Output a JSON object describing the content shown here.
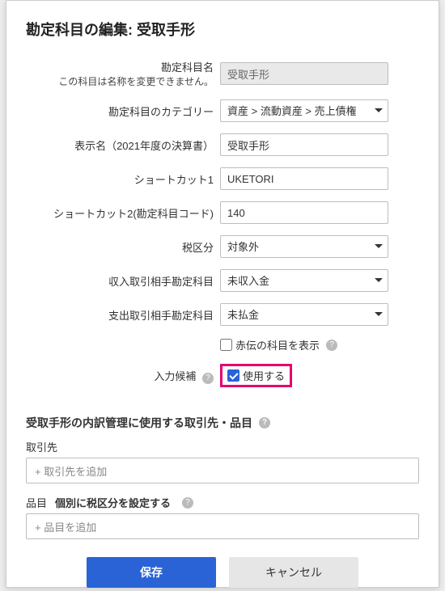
{
  "modal": {
    "title": "勘定科目の編集: 受取手形"
  },
  "form": {
    "name": {
      "label": "勘定科目名",
      "sublabel": "この科目は名称を変更できません。",
      "value": "受取手形"
    },
    "category": {
      "label": "勘定科目のカテゴリー",
      "selected": "資産 > 流動資産 > 売上債権"
    },
    "displayName": {
      "label": "表示名（2021年度の決算書）",
      "value": "受取手形"
    },
    "shortcut1": {
      "label": "ショートカット1",
      "value": "UKETORI"
    },
    "shortcut2": {
      "label": "ショートカット2(勘定科目コード)",
      "value": "140"
    },
    "tax": {
      "label": "税区分",
      "selected": "対象外"
    },
    "incomeAccount": {
      "label": "収入取引相手勘定科目",
      "selected": "未収入金"
    },
    "expenseAccount": {
      "label": "支出取引相手勘定科目",
      "selected": "未払金"
    },
    "redSlip": {
      "label": "赤伝の科目を表示",
      "checked": false
    },
    "suggestion": {
      "label": "入力候補",
      "checkbox_label": "使用する",
      "checked": true
    }
  },
  "detailSection": {
    "title": "受取手形の内訳管理に使用する取引先・品目",
    "partner": {
      "label": "取引先",
      "placeholder": "+ 取引先を追加"
    },
    "item": {
      "label": "品目",
      "sublink": "個別に税区分を設定する",
      "placeholder": "+ 品目を追加"
    }
  },
  "buttons": {
    "save": "保存",
    "cancel": "キャンセル"
  }
}
